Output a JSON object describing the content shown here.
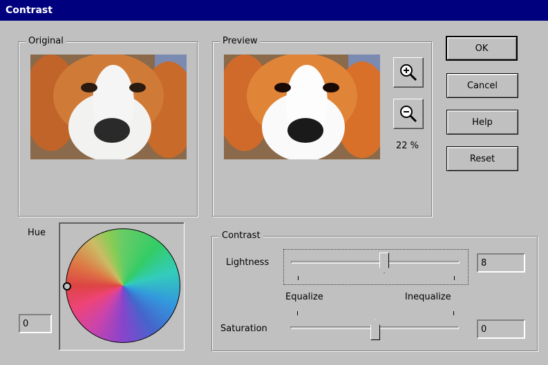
{
  "window": {
    "title": "Contrast"
  },
  "original": {
    "label": "Original"
  },
  "preview": {
    "label": "Preview",
    "zoom_text": "22 %"
  },
  "buttons": {
    "ok": "OK",
    "cancel": "Cancel",
    "help": "Help",
    "reset": "Reset"
  },
  "hue": {
    "label": "Hue",
    "value": "0"
  },
  "contrast": {
    "label": "Contrast",
    "lightness_label": "Lightness",
    "lightness_value": "8",
    "equalize_label": "Equalize",
    "inequalize_label": "Inequalize",
    "saturation_label": "Saturation",
    "saturation_value": "0"
  },
  "icons": {
    "zoom_in": "zoom-in-icon",
    "zoom_out": "zoom-out-icon"
  }
}
